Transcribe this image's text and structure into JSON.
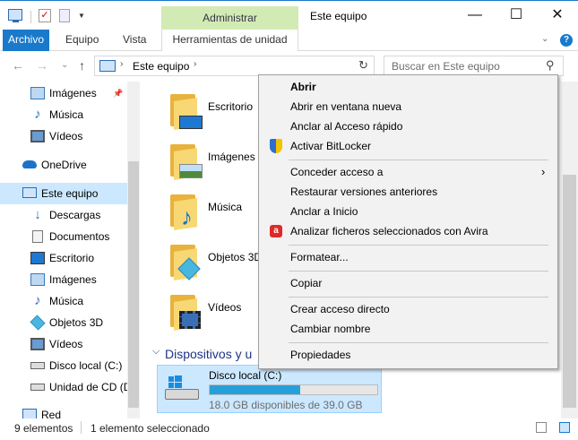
{
  "window": {
    "title": "Este equipo",
    "context_tab_header": "Administrar",
    "controls": {
      "minimize": "—",
      "maximize": "☐",
      "close": "✕"
    }
  },
  "ribbon": {
    "tabs": [
      "Archivo",
      "Equipo",
      "Vista",
      "Herramientas de unidad"
    ],
    "expand_glyph": "⌄",
    "help_glyph": "?"
  },
  "address": {
    "crumb": "Este equipo",
    "sep": "›",
    "refresh_glyph": "↻"
  },
  "nav_buttons": {
    "back": "←",
    "forward": "→",
    "recent": "⌄",
    "up": "↑"
  },
  "search": {
    "placeholder": "Buscar en Este equipo",
    "icon": "search-icon",
    "glyph": "⚲"
  },
  "nav_pane": {
    "items": [
      {
        "label": "Imágenes",
        "icon": "pictures-icon",
        "pin": "📌"
      },
      {
        "label": "Música",
        "icon": "music-icon"
      },
      {
        "label": "Vídeos",
        "icon": "videos-icon"
      },
      {
        "label": "OneDrive",
        "icon": "onedrive-icon"
      },
      {
        "label": "Este equipo",
        "icon": "this-pc-icon",
        "selected": true
      },
      {
        "label": "Descargas",
        "icon": "downloads-icon"
      },
      {
        "label": "Documentos",
        "icon": "documents-icon"
      },
      {
        "label": "Escritorio",
        "icon": "desktop-icon"
      },
      {
        "label": "Imágenes",
        "icon": "pictures-icon"
      },
      {
        "label": "Música",
        "icon": "music-icon"
      },
      {
        "label": "Objetos 3D",
        "icon": "3d-objects-icon"
      },
      {
        "label": "Vídeos",
        "icon": "videos-icon"
      },
      {
        "label": "Disco local (C:)",
        "icon": "drive-icon"
      },
      {
        "label": "Unidad de CD (D",
        "icon": "cd-drive-icon"
      },
      {
        "label": "Red",
        "icon": "network-icon"
      }
    ]
  },
  "folders": [
    {
      "name": "Escritorio",
      "icon": "desktop-folder-icon"
    },
    {
      "name": "Imágenes",
      "icon": "pictures-folder-icon"
    },
    {
      "name": "Música",
      "icon": "music-folder-icon"
    },
    {
      "name": "Objetos 3D",
      "icon": "3d-objects-folder-icon"
    },
    {
      "name": "Vídeos",
      "icon": "videos-folder-icon"
    }
  ],
  "devices_group": {
    "title": "Dispositivos y u",
    "chevron": "⌵"
  },
  "drive": {
    "name": "Disco local (C:)",
    "free_text": "18.0 GB disponibles de 39.0 GB",
    "used_fraction": 0.538,
    "bar_color": "#26a0da"
  },
  "status": {
    "items_count": "9 elementos",
    "selected": "1 elemento seleccionado"
  },
  "context_menu": {
    "items": [
      {
        "label": "Abrir",
        "bold": true
      },
      {
        "label": "Abrir en ventana nueva"
      },
      {
        "label": "Anclar al Acceso rápido"
      },
      {
        "label": "Activar BitLocker",
        "icon": "shield-icon"
      },
      {
        "sep": true
      },
      {
        "label": "Conceder acceso a",
        "submenu": true
      },
      {
        "label": "Restaurar versiones anteriores"
      },
      {
        "label": "Anclar a Inicio"
      },
      {
        "label": "Analizar ficheros seleccionados con Avira",
        "icon": "avira-icon"
      },
      {
        "sep": true
      },
      {
        "label": "Formatear..."
      },
      {
        "sep": true
      },
      {
        "label": "Copiar"
      },
      {
        "sep": true
      },
      {
        "label": "Crear acceso directo"
      },
      {
        "label": "Cambiar nombre"
      },
      {
        "sep": true
      },
      {
        "label": "Propiedades"
      }
    ]
  },
  "colors": {
    "accent": "#1979ca",
    "context_tab": "#d2ebb4",
    "selection": "#cce8ff"
  }
}
